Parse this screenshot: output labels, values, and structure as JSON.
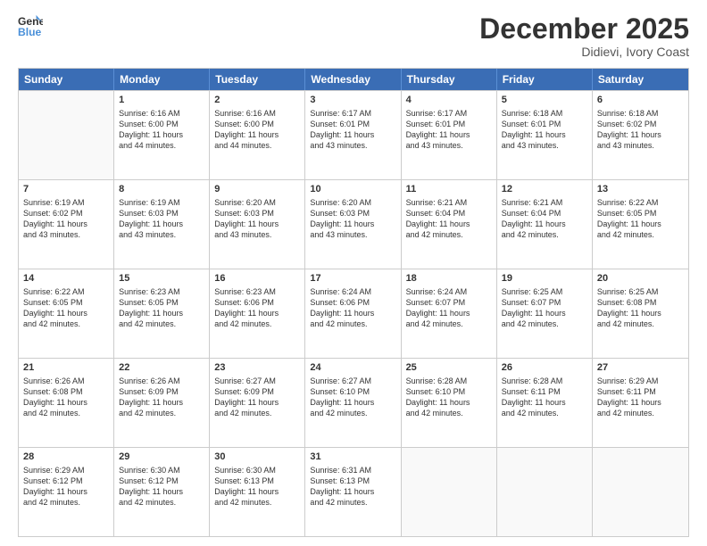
{
  "header": {
    "logo_line1": "General",
    "logo_line2": "Blue",
    "title": "December 2025",
    "subtitle": "Didievi, Ivory Coast"
  },
  "days": [
    "Sunday",
    "Monday",
    "Tuesday",
    "Wednesday",
    "Thursday",
    "Friday",
    "Saturday"
  ],
  "weeks": [
    [
      {
        "day": "",
        "info": ""
      },
      {
        "day": "1",
        "info": "Sunrise: 6:16 AM\nSunset: 6:00 PM\nDaylight: 11 hours\nand 44 minutes."
      },
      {
        "day": "2",
        "info": "Sunrise: 6:16 AM\nSunset: 6:00 PM\nDaylight: 11 hours\nand 44 minutes."
      },
      {
        "day": "3",
        "info": "Sunrise: 6:17 AM\nSunset: 6:01 PM\nDaylight: 11 hours\nand 43 minutes."
      },
      {
        "day": "4",
        "info": "Sunrise: 6:17 AM\nSunset: 6:01 PM\nDaylight: 11 hours\nand 43 minutes."
      },
      {
        "day": "5",
        "info": "Sunrise: 6:18 AM\nSunset: 6:01 PM\nDaylight: 11 hours\nand 43 minutes."
      },
      {
        "day": "6",
        "info": "Sunrise: 6:18 AM\nSunset: 6:02 PM\nDaylight: 11 hours\nand 43 minutes."
      }
    ],
    [
      {
        "day": "7",
        "info": "Sunrise: 6:19 AM\nSunset: 6:02 PM\nDaylight: 11 hours\nand 43 minutes."
      },
      {
        "day": "8",
        "info": "Sunrise: 6:19 AM\nSunset: 6:03 PM\nDaylight: 11 hours\nand 43 minutes."
      },
      {
        "day": "9",
        "info": "Sunrise: 6:20 AM\nSunset: 6:03 PM\nDaylight: 11 hours\nand 43 minutes."
      },
      {
        "day": "10",
        "info": "Sunrise: 6:20 AM\nSunset: 6:03 PM\nDaylight: 11 hours\nand 43 minutes."
      },
      {
        "day": "11",
        "info": "Sunrise: 6:21 AM\nSunset: 6:04 PM\nDaylight: 11 hours\nand 42 minutes."
      },
      {
        "day": "12",
        "info": "Sunrise: 6:21 AM\nSunset: 6:04 PM\nDaylight: 11 hours\nand 42 minutes."
      },
      {
        "day": "13",
        "info": "Sunrise: 6:22 AM\nSunset: 6:05 PM\nDaylight: 11 hours\nand 42 minutes."
      }
    ],
    [
      {
        "day": "14",
        "info": "Sunrise: 6:22 AM\nSunset: 6:05 PM\nDaylight: 11 hours\nand 42 minutes."
      },
      {
        "day": "15",
        "info": "Sunrise: 6:23 AM\nSunset: 6:05 PM\nDaylight: 11 hours\nand 42 minutes."
      },
      {
        "day": "16",
        "info": "Sunrise: 6:23 AM\nSunset: 6:06 PM\nDaylight: 11 hours\nand 42 minutes."
      },
      {
        "day": "17",
        "info": "Sunrise: 6:24 AM\nSunset: 6:06 PM\nDaylight: 11 hours\nand 42 minutes."
      },
      {
        "day": "18",
        "info": "Sunrise: 6:24 AM\nSunset: 6:07 PM\nDaylight: 11 hours\nand 42 minutes."
      },
      {
        "day": "19",
        "info": "Sunrise: 6:25 AM\nSunset: 6:07 PM\nDaylight: 11 hours\nand 42 minutes."
      },
      {
        "day": "20",
        "info": "Sunrise: 6:25 AM\nSunset: 6:08 PM\nDaylight: 11 hours\nand 42 minutes."
      }
    ],
    [
      {
        "day": "21",
        "info": "Sunrise: 6:26 AM\nSunset: 6:08 PM\nDaylight: 11 hours\nand 42 minutes."
      },
      {
        "day": "22",
        "info": "Sunrise: 6:26 AM\nSunset: 6:09 PM\nDaylight: 11 hours\nand 42 minutes."
      },
      {
        "day": "23",
        "info": "Sunrise: 6:27 AM\nSunset: 6:09 PM\nDaylight: 11 hours\nand 42 minutes."
      },
      {
        "day": "24",
        "info": "Sunrise: 6:27 AM\nSunset: 6:10 PM\nDaylight: 11 hours\nand 42 minutes."
      },
      {
        "day": "25",
        "info": "Sunrise: 6:28 AM\nSunset: 6:10 PM\nDaylight: 11 hours\nand 42 minutes."
      },
      {
        "day": "26",
        "info": "Sunrise: 6:28 AM\nSunset: 6:11 PM\nDaylight: 11 hours\nand 42 minutes."
      },
      {
        "day": "27",
        "info": "Sunrise: 6:29 AM\nSunset: 6:11 PM\nDaylight: 11 hours\nand 42 minutes."
      }
    ],
    [
      {
        "day": "28",
        "info": "Sunrise: 6:29 AM\nSunset: 6:12 PM\nDaylight: 11 hours\nand 42 minutes."
      },
      {
        "day": "29",
        "info": "Sunrise: 6:30 AM\nSunset: 6:12 PM\nDaylight: 11 hours\nand 42 minutes."
      },
      {
        "day": "30",
        "info": "Sunrise: 6:30 AM\nSunset: 6:13 PM\nDaylight: 11 hours\nand 42 minutes."
      },
      {
        "day": "31",
        "info": "Sunrise: 6:31 AM\nSunset: 6:13 PM\nDaylight: 11 hours\nand 42 minutes."
      },
      {
        "day": "",
        "info": ""
      },
      {
        "day": "",
        "info": ""
      },
      {
        "day": "",
        "info": ""
      }
    ]
  ]
}
